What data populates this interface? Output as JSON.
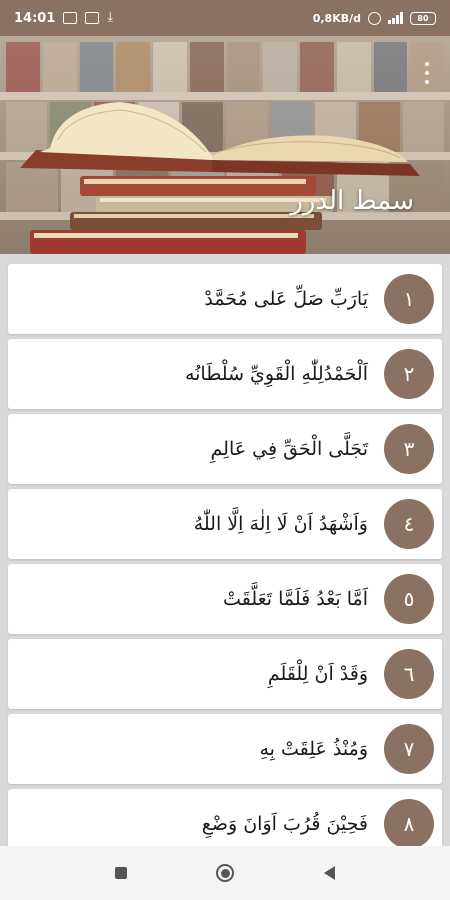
{
  "status_bar": {
    "time": "14:01",
    "network_speed": "0,8KB/d",
    "battery_level": "80"
  },
  "header": {
    "title": "سمط الدرر"
  },
  "items": [
    {
      "number": "١",
      "text": "يَارَبِّ صَلِّ عَلى مُحَمَّدْ"
    },
    {
      "number": "٢",
      "text": "اَلْحَمْدُلِلّٰهِ الْقَوِيِّ سُلْطَانُه"
    },
    {
      "number": "٣",
      "text": "تَجَلَّى الْحَقِّ فِي عَالِمِ"
    },
    {
      "number": "٤",
      "text": "وَاَشْهَدُ اَنْ لَا اِلٰهَ اِلَّا اللّٰهُ"
    },
    {
      "number": "٥",
      "text": "اَمَّا بَعْدُ فَلَمَّا تَعَلَّقَتْ"
    },
    {
      "number": "٦",
      "text": "وَقَدْ اَنْ لِلْقَلَمِ"
    },
    {
      "number": "٧",
      "text": "وَمُنْذُ عَلِقَتْ بِهِ"
    },
    {
      "number": "٨",
      "text": "فَحِيْنَ قُرُبَ اَوَانَ وَضْعِ"
    }
  ],
  "colors": {
    "accent": "#8a7161",
    "card_bg": "#ffffff",
    "list_bg": "#d9d9d9"
  }
}
